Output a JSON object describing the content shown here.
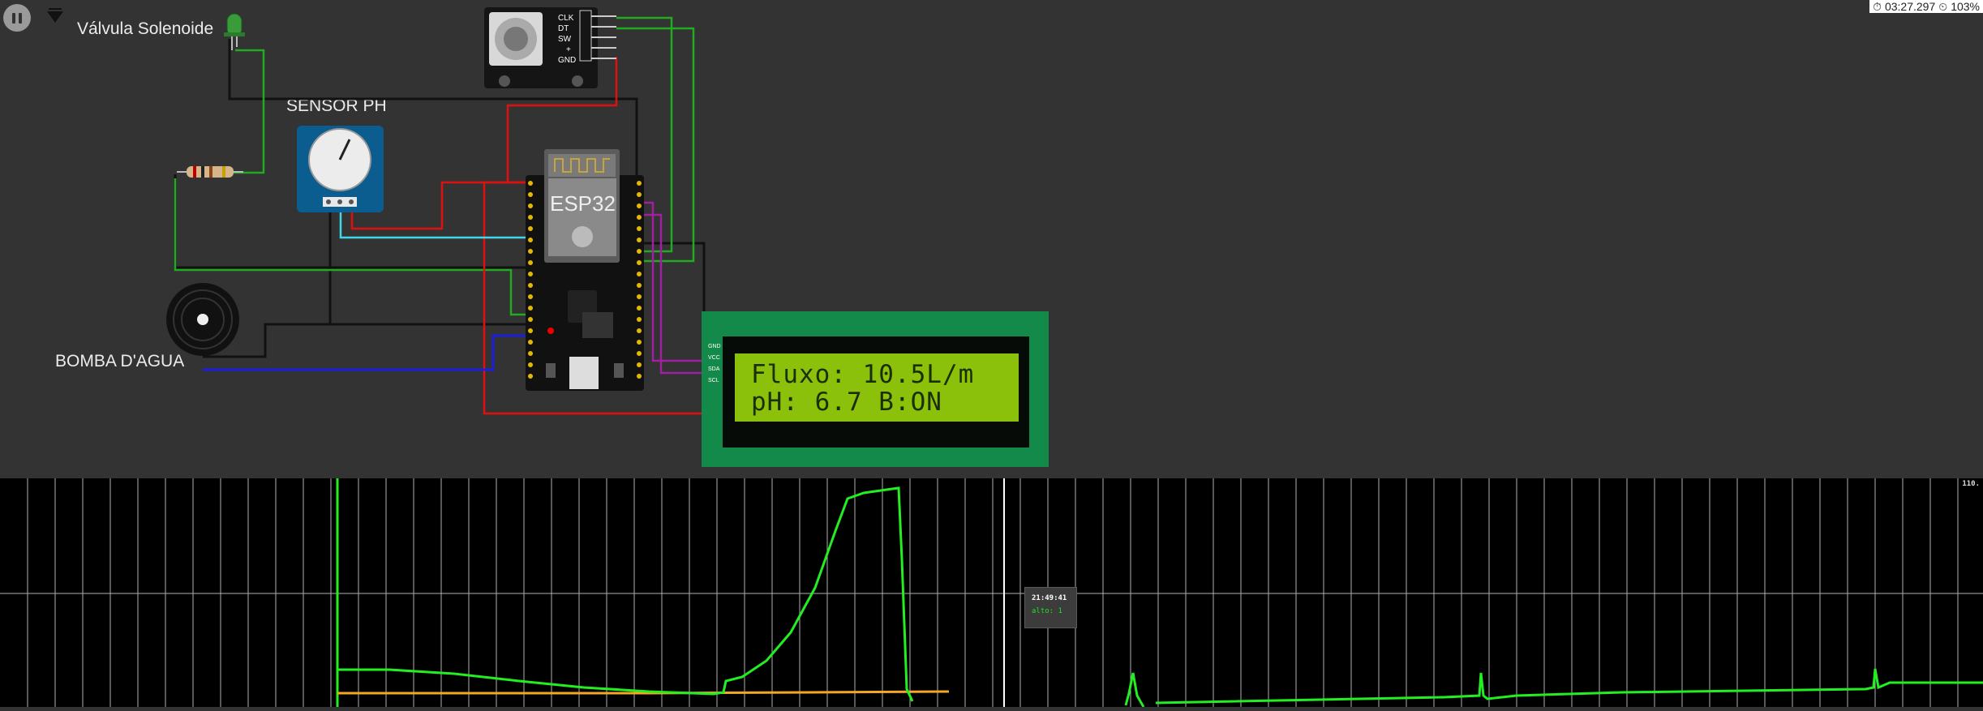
{
  "toolbar": {
    "pause_icon": "pause-icon",
    "wifi_icon": "wifi-icon"
  },
  "timer": {
    "elapsed": "03:27.297",
    "speed": "103%"
  },
  "components": {
    "valve_label": "Válvula Solenoide",
    "sensor_label": "SENSOR PH",
    "pump_label": "BOMBA D'AGUA",
    "mcu_label": "ESP32",
    "encoder_pins": [
      "CLK",
      "DT",
      "SW",
      "+",
      "GND"
    ],
    "lcd_pins": [
      "GND",
      "VCC",
      "SDA",
      "SCL"
    ]
  },
  "lcd": {
    "line1": "Fluxo: 10.5L/m",
    "line2": "pH: 6.7 B:ON"
  },
  "plot": {
    "ymax_label": "110.",
    "tooltip_time": "21:49:41",
    "tooltip_value": "alto: 1"
  },
  "colors": {
    "background": "#333333",
    "plot_bg": "#000000",
    "lcd_board": "#138a4a",
    "lcd_screen": "#8bc10a",
    "trace_green": "#22ee22",
    "trace_orange": "#f5a623",
    "wire_red": "#e01010",
    "wire_green": "#22aa22",
    "wire_cyan": "#3fd8e8",
    "wire_blue": "#1a1aff",
    "wire_purple": "#a020a0"
  }
}
